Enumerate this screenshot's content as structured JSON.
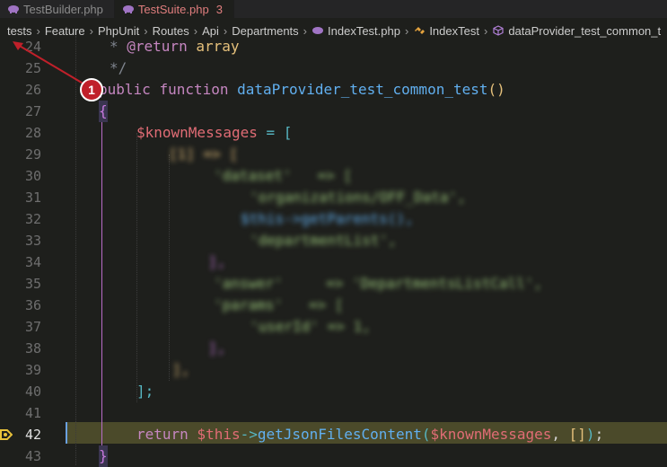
{
  "tabs": [
    {
      "label": "TestBuilder.php",
      "dirty": ""
    },
    {
      "label": "TestSuite.php",
      "dirty": "3"
    }
  ],
  "breadcrumb": [
    "tests",
    "Feature",
    "PhpUnit",
    "Routes",
    "Api",
    "Departments",
    "IndexTest.php",
    "IndexTest",
    "dataProvider_test_common_t"
  ],
  "lines": [
    "24",
    "25",
    "26",
    "27",
    "28",
    "29",
    "30",
    "31",
    "32",
    "33",
    "34",
    "35",
    "36",
    "37",
    "38",
    "39",
    "40",
    "41",
    "42",
    "43"
  ],
  "code": {
    "l24_a": "* ",
    "l24_b": "@return",
    "l24_c": " array",
    "l25": "*/",
    "l26_kw1": "public",
    "l26_kw2": "function",
    "l26_fn": "dataProvider_test_common_test",
    "l26_paren": "()",
    "l27": "{",
    "l28_var": "$knownMessages",
    "l28_op": " = ",
    "l28_br": "[",
    "l30": "'dataset'   => [",
    "l31": "'organizations/OFF_Data',",
    "l32": "$this->getParents(),",
    "l33": "'departmentList',",
    "l34": "],",
    "l35": "'answer'     => 'DepartmentsListCall',",
    "l36": "'params'   => [",
    "l37": "'userId' => 1,",
    "l38": "],",
    "l39": "],",
    "l29": "[1] => [",
    "l40": "];",
    "l42_kw": "return",
    "l42_var1": " $this",
    "l42_arrow": "->",
    "l42_fn": "getJsonFilesContent",
    "l42_p1": "(",
    "l42_var2": "$knownMessages",
    "l42_comma": ", ",
    "l42_arr": "[]",
    "l42_p2": ")",
    "l42_semi": ";",
    "l43": "}"
  },
  "annotation": {
    "marker": "1"
  }
}
